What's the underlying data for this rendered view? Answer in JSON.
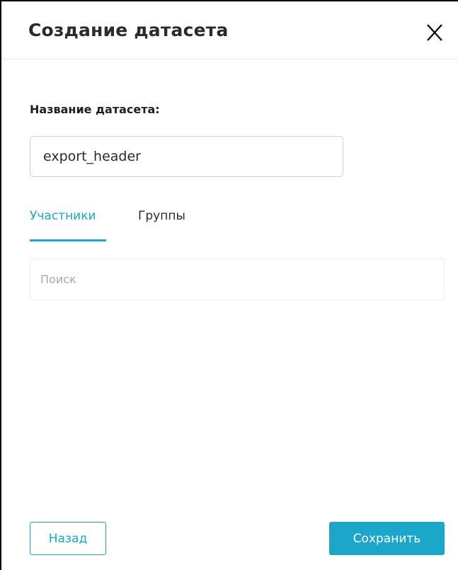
{
  "dialog": {
    "title": "Создание датасета",
    "close_icon": "close-icon"
  },
  "form": {
    "name_label": "Название датасета:",
    "name_value": "export_header"
  },
  "tabs": [
    {
      "label": "Участники",
      "active": true
    },
    {
      "label": "Группы",
      "active": false
    }
  ],
  "search": {
    "placeholder": "Поиск",
    "value": ""
  },
  "footer": {
    "back_label": "Назад",
    "save_label": "Сохранить"
  },
  "colors": {
    "accent": "#1aa7c9",
    "text": "#2b2b2b",
    "border": "#cfcfcf"
  }
}
